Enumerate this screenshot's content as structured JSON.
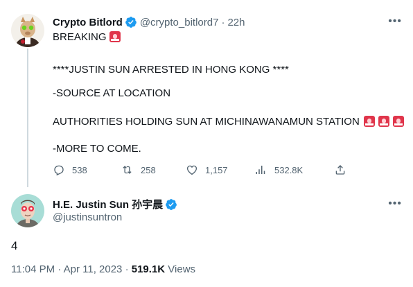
{
  "tweet1": {
    "author_name": "Crypto Bitlord",
    "handle": "@crypto_bitlord7",
    "separator": "·",
    "time": "22h",
    "lines": [
      "BREAKING",
      "****JUSTIN SUN ARRESTED IN HONG KONG ****",
      "-SOURCE AT LOCATION",
      "AUTHORITIES HOLDING SUN AT MICHINAWANAMUN STATION",
      "-MORE TO COME."
    ],
    "actions": {
      "replies": "538",
      "retweets": "258",
      "likes": "1,157",
      "views": "532.8K"
    },
    "icons": [
      "verified-badge-icon",
      "siren-emoji-icon",
      "reply-icon",
      "retweet-icon",
      "like-icon",
      "views-icon",
      "share-icon",
      "more-icon"
    ]
  },
  "tweet2": {
    "author_name": "H.E. Justin Sun 孙宇晨",
    "handle": "@justinsuntron",
    "text": "4",
    "time": "11:04 PM",
    "dot1": "·",
    "date": "Apr 11, 2023",
    "dot2": "·",
    "views_count": "519.1K",
    "views_label": "Views"
  },
  "colors": {
    "text": "#0f1419",
    "muted": "#536471",
    "verified": "#1d9bf0",
    "thread_line": "#cfd9de"
  }
}
